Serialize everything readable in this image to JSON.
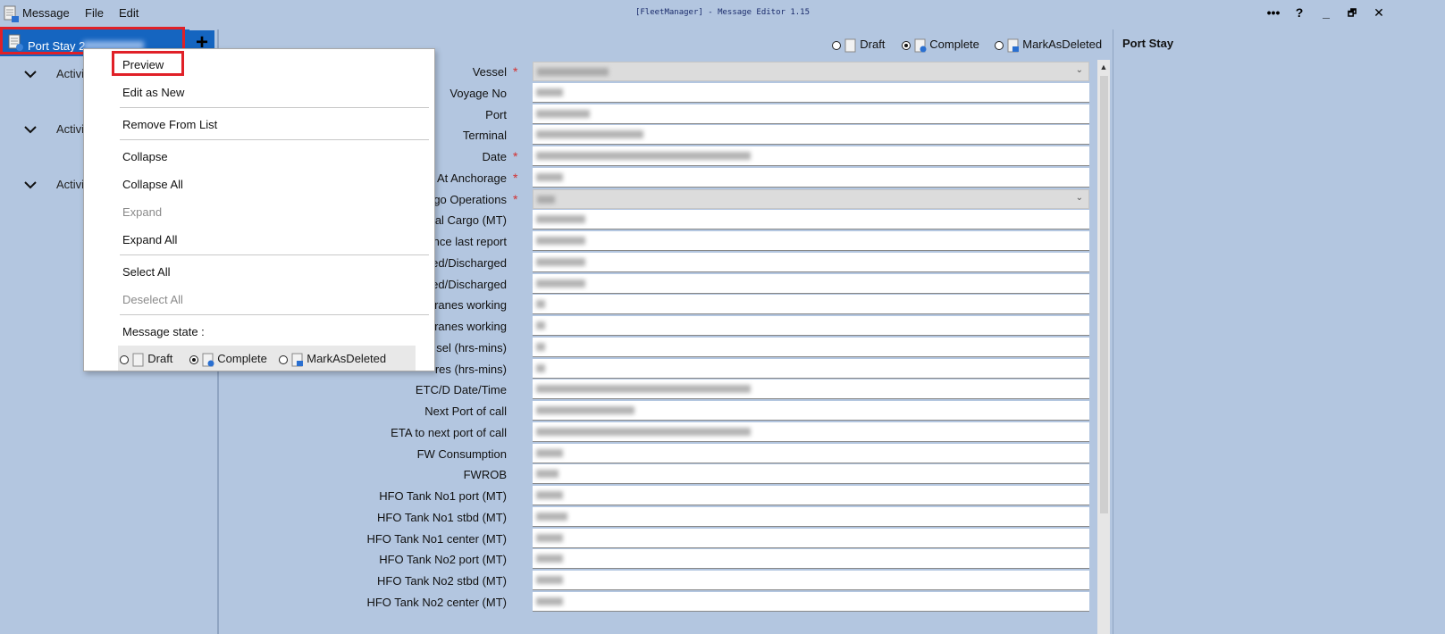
{
  "titlebar": {
    "menu": [
      "Message",
      "File",
      "Edit"
    ],
    "title": "[FleetManager] - Message Editor 1.15",
    "controls": {
      "more": "•••",
      "help": "?",
      "minimize": "_",
      "restore": "🗗",
      "close": "✕"
    }
  },
  "tree": {
    "selected_label": "Port Stay 2",
    "add_label": "+",
    "activities": [
      "Activi",
      "Activi",
      "Activi"
    ]
  },
  "context_menu": {
    "items": [
      "Preview",
      "Edit as New",
      "Remove From List",
      "Collapse",
      "Collapse All",
      "Expand",
      "Expand All",
      "Select All",
      "Deselect All"
    ],
    "state_label": "Message state :",
    "states": [
      "Draft",
      "Complete",
      "MarkAsDeleted"
    ],
    "selected_state": "Complete"
  },
  "form": {
    "states": [
      "Draft",
      "Complete",
      "MarkAsDeleted"
    ],
    "selected_state": "Complete",
    "fields": [
      {
        "label": "Vessel",
        "required": true
      },
      {
        "label": "Voyage No",
        "required": false
      },
      {
        "label": "Port",
        "required": false
      },
      {
        "label": "Terminal",
        "required": false
      },
      {
        "label": "Date",
        "required": true
      },
      {
        "label": "At Anchorage",
        "required": true
      },
      {
        "label": "go Operations",
        "required": true
      },
      {
        "label": "tal Cargo (MT)",
        "required": false
      },
      {
        "label": "nce last report",
        "required": false
      },
      {
        "label": "ed/Discharged",
        "required": false
      },
      {
        "label": "ed/Discharged",
        "required": false
      },
      {
        "label": "ranes working",
        "required": false
      },
      {
        "label": "ranes working",
        "required": false
      },
      {
        "label": "sel (hrs-mins)",
        "required": false
      },
      {
        "label": "res (hrs-mins)",
        "required": false
      },
      {
        "label": "ETC/D Date/Time",
        "required": false
      },
      {
        "label": "Next Port of call",
        "required": false
      },
      {
        "label": "ETA to next port of call",
        "required": false
      },
      {
        "label": "FW Consumption",
        "required": false
      },
      {
        "label": "FWROB",
        "required": false
      },
      {
        "label": "HFO Tank No1 port (MT)",
        "required": false
      },
      {
        "label": "HFO Tank No1 stbd (MT)",
        "required": false
      },
      {
        "label": "HFO Tank No1 center (MT)",
        "required": false
      },
      {
        "label": "HFO Tank No2 port (MT)",
        "required": false
      },
      {
        "label": "HFO Tank No2 stbd (MT)",
        "required": false
      },
      {
        "label": "HFO Tank No2 center (MT)",
        "required": false
      }
    ]
  },
  "preview_panel": {
    "title": "Port Stay"
  },
  "colors": {
    "background": "#b3c6e0",
    "selection": "#1565c0",
    "highlight_box": "#e02027",
    "required": "#d32f2f"
  }
}
